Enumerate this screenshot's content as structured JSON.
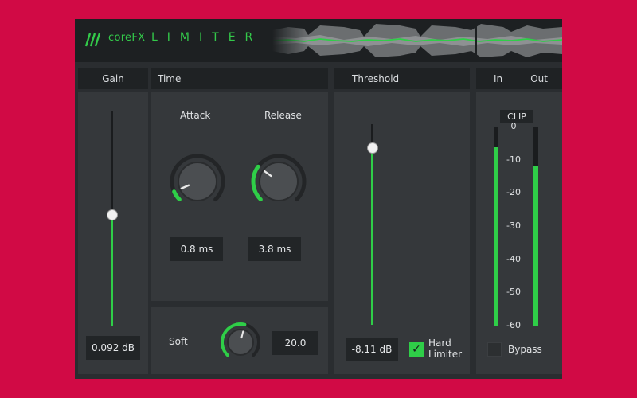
{
  "header": {
    "brand": "coreFX",
    "product": "LIMITER",
    "logo_icon": "triple-slash-logo-icon"
  },
  "colors": {
    "background": "#d10a45",
    "panel": "#2a2d30",
    "accent": "#2fce48"
  },
  "sections": {
    "gain": "Gain",
    "time": "Time",
    "threshold": "Threshold",
    "in": "In",
    "out": "Out"
  },
  "gain": {
    "readout": "0.092 dB",
    "slider_level": 0.52
  },
  "time": {
    "attack_label": "Attack",
    "attack_readout": "0.8 ms",
    "attack_level": 0.08,
    "release_label": "Release",
    "release_readout": "3.8 ms",
    "release_level": 0.3
  },
  "soft": {
    "label": "Soft",
    "readout": "20.0",
    "level": 0.55
  },
  "threshold": {
    "readout": "-8.11 dB",
    "slider_level": 0.88,
    "hard_limiter_label": "Hard Limiter",
    "hard_limiter_checked": true
  },
  "meters": {
    "clip_label": "CLIP",
    "scale": [
      "0",
      "-10",
      "-20",
      "-30",
      "-40",
      "-50",
      "-60"
    ],
    "in_level": 0.9,
    "out_level": 0.81,
    "bypass_label": "Bypass",
    "bypass_checked": false
  }
}
